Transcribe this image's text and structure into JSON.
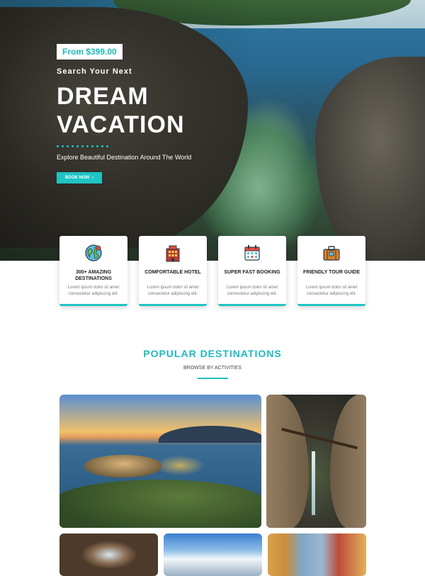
{
  "hero": {
    "price": "From $399.00",
    "subtitle": "Search Your Next",
    "title_line1": "DREAM",
    "title_line2": "VACATION",
    "description": "Explore Beautiful Destination Around The World",
    "button_label": "BOOK NOW",
    "button_arrow": "›"
  },
  "features": [
    {
      "title": "300+ AMAZING DESTINATIONS",
      "desc": "Lorem ipsum dolor sit amet consectetur adipiscing elit.",
      "icon": "globe-icon"
    },
    {
      "title": "COMFORTABLE HOTEL",
      "desc": "Lorem ipsum dolor sit amet consectetur adipiscing elit.",
      "icon": "hotel-icon"
    },
    {
      "title": "SUPER FAST BOOKING",
      "desc": "Lorem ipsum dolor sit amet consectetur adipiscing elit.",
      "icon": "calendar-icon"
    },
    {
      "title": "FRIENDLY TOUR GUIDE",
      "desc": "Lorem ipsum dolor sit amet consectetur adipiscing elit.",
      "icon": "suitcase-icon"
    }
  ],
  "section": {
    "title": "POPULAR DESTINATIONS",
    "subtitle": "BROWSE BY ACTIVITIES"
  },
  "colors": {
    "accent": "#1fc4c4",
    "heading_accent": "#1fb8c0"
  }
}
